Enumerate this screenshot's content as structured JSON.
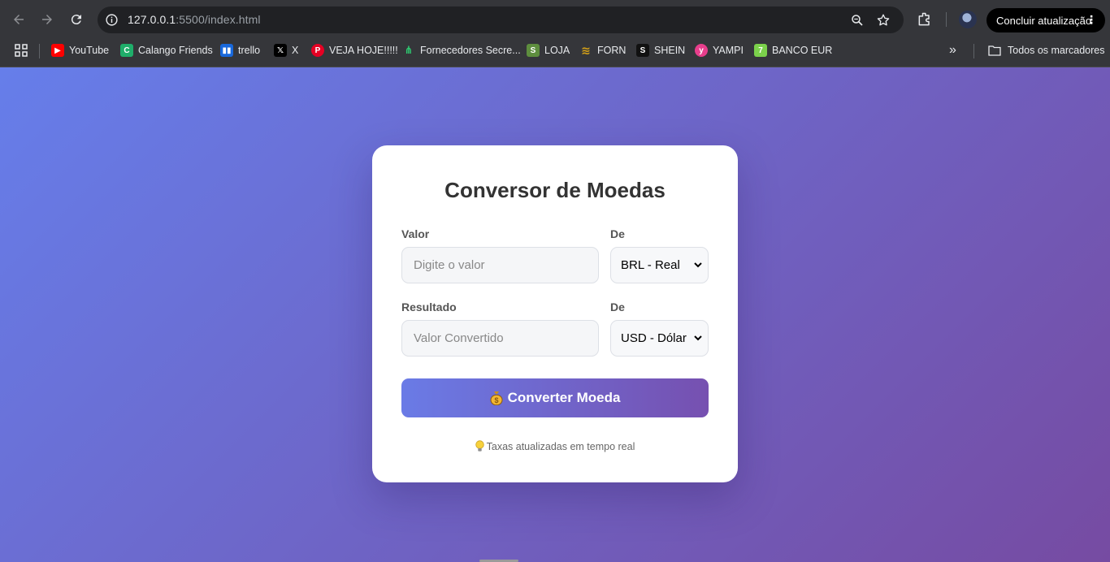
{
  "browser": {
    "url_host": "127.0.0.1",
    "url_rest": ":5500/index.html",
    "update_button": "Concluir atualização",
    "bookmarks": [
      {
        "label": "YouTube",
        "color": "#ff0000"
      },
      {
        "label": "Calango Friends",
        "color": "#1fae6a"
      },
      {
        "label": "trello",
        "color": "#1868db"
      },
      {
        "label": "X",
        "color": "#000000"
      },
      {
        "label": "VEJA HOJE!!!!!",
        "color": "#e60023"
      },
      {
        "label": "Fornecedores Secre...",
        "color": "#2ecc71"
      },
      {
        "label": "LOJA",
        "color": "#5e8e3e"
      },
      {
        "label": "FORN",
        "color": "#d4a017"
      },
      {
        "label": "SHEIN",
        "color": "#111111"
      },
      {
        "label": "YAMPI",
        "color": "#e83e8c"
      },
      {
        "label": "BANCO EUR",
        "color": "#7bd14b"
      }
    ],
    "all_bookmarks": "Todos os marcadores"
  },
  "converter": {
    "title": "Conversor de Moedas",
    "value_label": "Valor",
    "value_placeholder": "Digite o valor",
    "from_label": "De",
    "from_selected": "BRL - Real",
    "result_label": "Resultado",
    "result_placeholder": "Valor Convertido",
    "to_label": "De",
    "to_selected": "USD - Dólar",
    "button_label": "Converter Moeda",
    "info_text": "Taxas atualizadas em tempo real"
  },
  "colors": {
    "gradient_start": "#667eea",
    "gradient_end": "#764ba2"
  }
}
